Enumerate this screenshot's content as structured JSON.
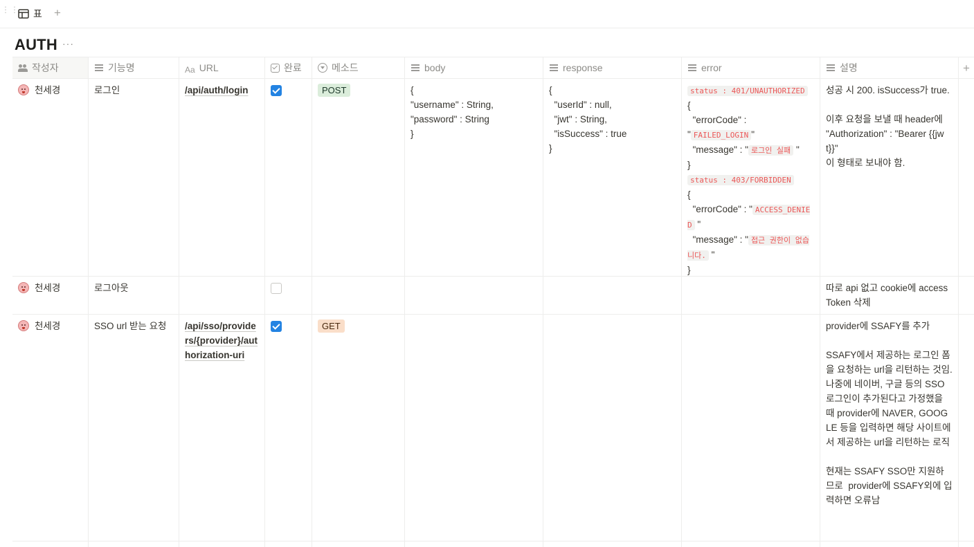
{
  "toolbar": {
    "view_label": "표",
    "add_view": "+"
  },
  "database": {
    "title": "AUTH",
    "more": "···"
  },
  "columns": {
    "author": "작성자",
    "feature": "기능명",
    "url_prefix": "Aa",
    "url": "URL",
    "done": "완료",
    "method": "메소드",
    "body": "body",
    "response": "response",
    "error": "error",
    "description": "설명",
    "add": "+"
  },
  "rows": [
    {
      "author": "천세경",
      "feature": "로그인",
      "url": "/api/auth/login",
      "done": true,
      "method": "POST",
      "body": "{\n\"username\" : String,\n\"password\" : String\n}",
      "response": "{\n  \"userId\" : null,\n  \"jwt\" : String,\n  \"isSuccess\" : true\n}",
      "error": {
        "status1": "status : 401/UNAUTHORIZED",
        "open1": "{",
        "code_label1": "  \"errorCode\" :\n\"",
        "code1": "FAILED_LOGIN",
        "code_end1": "\"",
        "msg_label1": "  \"message\" : \"",
        "msg1": "로그인 실패",
        "msg_end1": "\"",
        "close1": "}",
        "status2": "status : 403/FORBIDDEN",
        "open2": "{",
        "code_label2": "  \"errorCode\" : \"",
        "code2": "ACCESS_DENIED",
        "code_end2": "\"",
        "msg_label2": "  \"message\" : \"",
        "msg2": "접근 권한이 없습니다.",
        "msg_end2": "\"",
        "close2": "}"
      },
      "description": "성공 시 200. isSuccess가 true.\n\n이후 요청을 보낼 때 header에 \"Authorization\" : \"Bearer {{jwt}}\"\n이 형태로 보내야 함."
    },
    {
      "author": "천세경",
      "feature": "로그아웃",
      "url": "",
      "done": false,
      "method": "",
      "body": "",
      "response": "",
      "description": "따로 api 없고 cookie에 accessToken 삭제"
    },
    {
      "author": "천세경",
      "feature": "SSO url 받는 요청",
      "url": "/api/sso/providers/{provider}/authorization-uri",
      "done": true,
      "method": "GET",
      "body": "",
      "response": "",
      "description": "provider에 SSAFY를 추가\n\nSSAFY에서 제공하는 로그인 폼을 요청하는 url을 리턴하는 것임.\n나중에 네이버, 구글 등의 SSO 로그인이 추가된다고 가정했을 때 provider에 NAVER, GOOGLE 등을 입력하면 해당 사이트에서 제공하는 url을 리턴하는 로직\n\n현재는 SSAFY SSO만 지원하므로  provider에 SSAFY외에 입력하면 오류남"
    }
  ]
}
